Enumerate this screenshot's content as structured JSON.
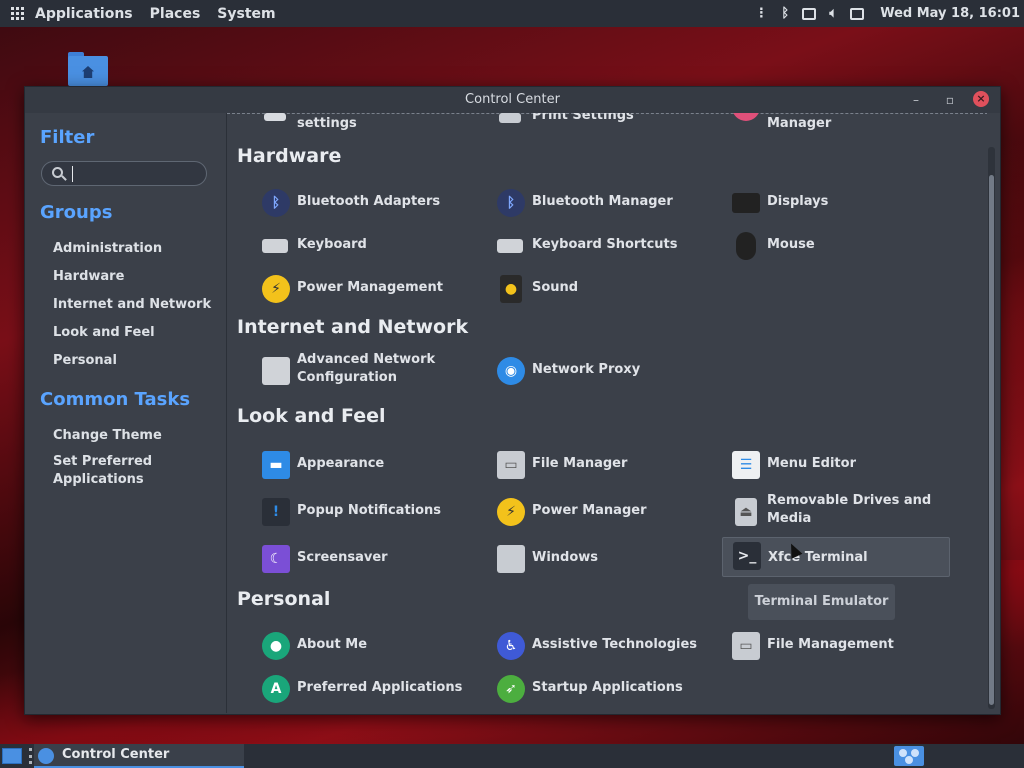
{
  "top_panel": {
    "menus": [
      "Applications",
      "Places",
      "System"
    ],
    "clock": "Wed May 18, 16:01",
    "tray_icons": [
      "more-icon",
      "bluetooth-icon",
      "keyboard-icon",
      "volume-icon",
      "notification-icon"
    ]
  },
  "window": {
    "title": "Control Center",
    "buttons": [
      "minimize-icon",
      "maximize-icon",
      "close-icon"
    ]
  },
  "sidebar": {
    "filter_heading": "Filter",
    "search": {
      "value": "",
      "placeholder": ""
    },
    "groups_heading": "Groups",
    "groups": [
      "Administration",
      "Hardware",
      "Internet and Network",
      "Look and Feel",
      "Personal"
    ],
    "tasks_heading": "Common Tasks",
    "tasks": [
      "Change Theme",
      "Set Preferred Applications"
    ]
  },
  "content": {
    "partial_top": [
      "settings",
      "Print Settings",
      "Manager"
    ],
    "sections": {
      "hardware": {
        "title": "Hardware",
        "items": [
          "Bluetooth Adapters",
          "Bluetooth Manager",
          "Displays",
          "Keyboard",
          "Keyboard Shortcuts",
          "Mouse",
          "Power Management",
          "Sound"
        ]
      },
      "internet": {
        "title": "Internet and Network",
        "items": [
          "Advanced Network Configuration",
          "Network Proxy"
        ]
      },
      "look": {
        "title": "Look and Feel",
        "items": [
          "Appearance",
          "File Manager",
          "Menu Editor",
          "Popup Notifications",
          "Power Manager",
          "Removable Drives and Media",
          "Screensaver",
          "Windows",
          "Xfce Terminal"
        ]
      },
      "personal": {
        "title": "Personal",
        "items": [
          "About Me",
          "Assistive Technologies",
          "File Management",
          "Preferred Applications",
          "Startup Applications"
        ]
      }
    },
    "tooltip": "Terminal Emulator"
  },
  "bottom_panel": {
    "task_label": "Control Center"
  },
  "colors": {
    "accent": "#5aa4ff",
    "panel": "#2a2f38",
    "window_bg": "#3b4049",
    "close": "#e0505c"
  }
}
